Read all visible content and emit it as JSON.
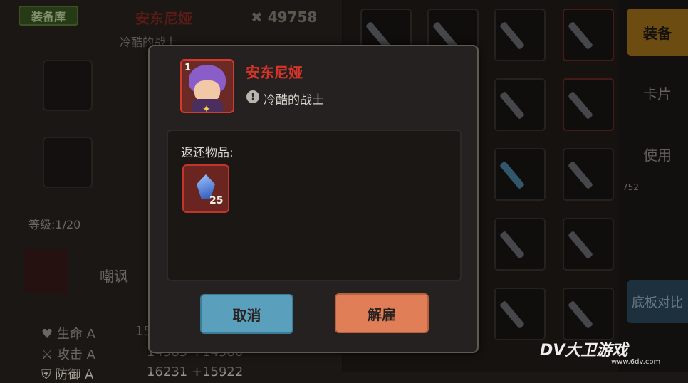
{
  "background": {
    "tag": "装备库",
    "hero_name": "安东尼娅",
    "subtitle": "冷酷的战士",
    "power": "49758",
    "level": "等级:1/20",
    "skill": "嘲讽",
    "stats": [
      {
        "label": "生命 A",
        "value": "15..."
      },
      {
        "label": "攻击 A",
        "value": "14585 +14580"
      },
      {
        "label": "防御 A",
        "value": "16231 +15922"
      }
    ],
    "right_tabs": [
      "装备",
      "卡片",
      "使用",
      "底板对比"
    ],
    "right_number": "752"
  },
  "dialog": {
    "hero": {
      "level": "1",
      "name": "安东尼娅",
      "trait": "冷酷的战士"
    },
    "returns_title": "返还物品:",
    "items": [
      {
        "icon": "crystal-icon",
        "count": "25"
      }
    ],
    "cancel_label": "取消",
    "dismiss_label": "解雇"
  },
  "watermark": {
    "brand": "DV大卫游戏",
    "url": "www.6dv.com"
  },
  "colors": {
    "accent_red": "#d8352a",
    "cancel": "#5aa0bd",
    "dismiss": "#e07f57",
    "equip": "#a8751c"
  }
}
